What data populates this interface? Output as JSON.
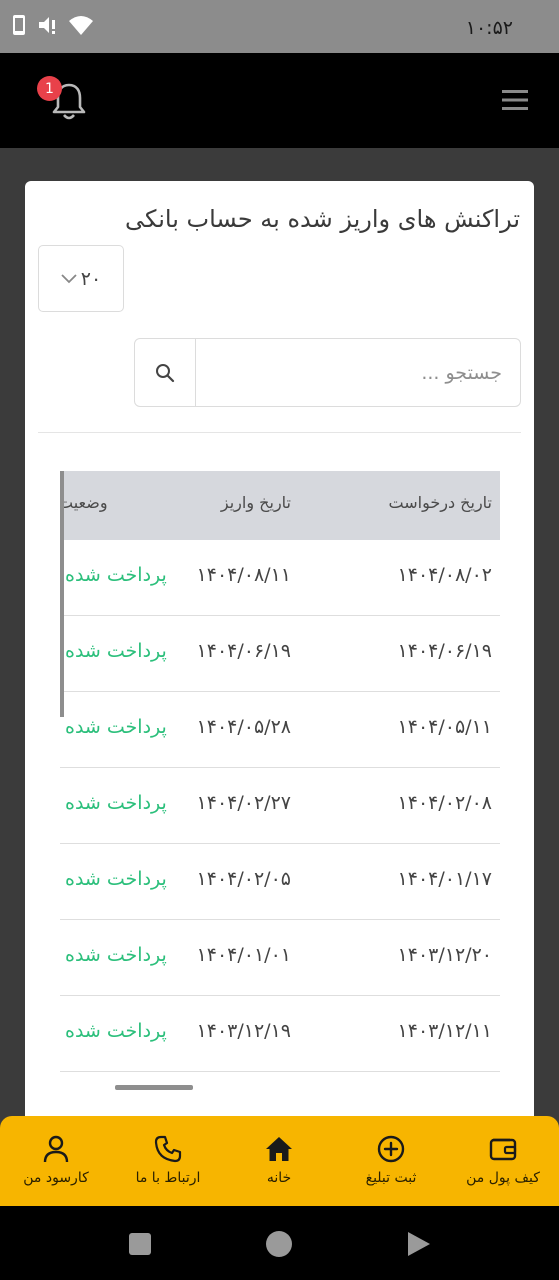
{
  "status_bar": {
    "time": "۱۰:۵۲"
  },
  "header": {
    "notification_count": "1"
  },
  "card": {
    "title": "تراکنش های واریز شده به حساب بانکی",
    "page_size": "۲۰",
    "search_placeholder": "جستجو ..."
  },
  "table": {
    "headers": {
      "request_date": "تاریخ درخواست",
      "deposit_date": "تاریخ واریز",
      "status": "وضعیت"
    },
    "rows": [
      {
        "request_date": "۱۴۰۴/۰۸/۰۲",
        "deposit_date": "۱۴۰۴/۰۸/۱۱",
        "status": "پرداخت شده"
      },
      {
        "request_date": "۱۴۰۴/۰۶/۱۹",
        "deposit_date": "۱۴۰۴/۰۶/۱۹",
        "status": "پرداخت شده"
      },
      {
        "request_date": "۱۴۰۴/۰۵/۱۱",
        "deposit_date": "۱۴۰۴/۰۵/۲۸",
        "status": "پرداخت شده"
      },
      {
        "request_date": "۱۴۰۴/۰۲/۰۸",
        "deposit_date": "۱۴۰۴/۰۲/۲۷",
        "status": "پرداخت شده"
      },
      {
        "request_date": "۱۴۰۴/۰۱/۱۷",
        "deposit_date": "۱۴۰۴/۰۲/۰۵",
        "status": "پرداخت شده"
      },
      {
        "request_date": "۱۴۰۳/۱۲/۲۰",
        "deposit_date": "۱۴۰۴/۰۱/۰۱",
        "status": "پرداخت شده"
      },
      {
        "request_date": "۱۴۰۳/۱۲/۱۱",
        "deposit_date": "۱۴۰۳/۱۲/۱۹",
        "status": "پرداخت شده"
      }
    ]
  },
  "bottom_nav": {
    "wallet": "کیف پول من",
    "post_ad": "ثبت تبلیغ",
    "home": "خانه",
    "contact": "ارتباط با ما",
    "profit": "کارسود من"
  },
  "colors": {
    "accent": "#f7b500",
    "status_paid": "#2bbf7b",
    "badge": "#e8414a"
  },
  "icons": [
    "phone-icon",
    "mute-icon",
    "wifi-icon",
    "bell-icon",
    "menu-icon",
    "search-icon",
    "chevron-down-icon",
    "wallet-icon",
    "plus-circle-icon",
    "home-icon",
    "phone-call-icon",
    "user-icon",
    "square-icon",
    "circle-icon",
    "back-triangle-icon"
  ]
}
